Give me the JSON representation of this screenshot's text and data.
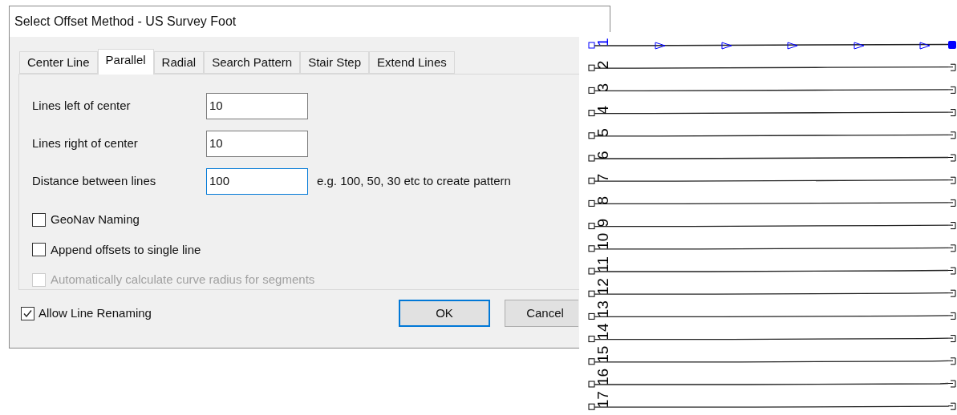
{
  "window": {
    "title": "Select Offset Method - US Survey Foot"
  },
  "tabs": [
    {
      "label": "Center Line",
      "selected": false
    },
    {
      "label": "Parallel",
      "selected": true
    },
    {
      "label": "Radial",
      "selected": false
    },
    {
      "label": "Search Pattern",
      "selected": false
    },
    {
      "label": "Stair Step",
      "selected": false
    },
    {
      "label": "Extend Lines",
      "selected": false
    }
  ],
  "fields": [
    {
      "label": "Lines left of center",
      "value": "10",
      "focused": false
    },
    {
      "label": "Lines right of center",
      "value": "10",
      "focused": false
    },
    {
      "label": "Distance between lines",
      "value": "100",
      "focused": true,
      "hint": "e.g. 100, 50, 30 etc to create pattern"
    }
  ],
  "options": [
    {
      "label": "GeoNav Naming",
      "checked": false,
      "disabled": false
    },
    {
      "label": "Append offsets to single line",
      "checked": false,
      "disabled": false
    },
    {
      "label": "Automatically calculate curve radius for segments",
      "checked": false,
      "disabled": true
    }
  ],
  "allow_renaming": {
    "label": "Allow Line Renaming",
    "checked": true
  },
  "buttons": [
    {
      "label": "OK",
      "default": true
    },
    {
      "label": "Cancel",
      "default": false
    }
  ],
  "canvas": {
    "lines": [
      {
        "label": "1",
        "selected": true
      },
      {
        "label": "2",
        "selected": false
      },
      {
        "label": "3",
        "selected": false
      },
      {
        "label": "4",
        "selected": false
      },
      {
        "label": "5",
        "selected": false
      },
      {
        "label": "6",
        "selected": false
      },
      {
        "label": "7",
        "selected": false
      },
      {
        "label": "8",
        "selected": false
      },
      {
        "label": "9",
        "selected": false
      },
      {
        "label": "10",
        "selected": false
      },
      {
        "label": "11",
        "selected": false
      },
      {
        "label": "12",
        "selected": false
      },
      {
        "label": "13",
        "selected": false
      },
      {
        "label": "14",
        "selected": false
      },
      {
        "label": "15",
        "selected": false
      },
      {
        "label": "16",
        "selected": false
      },
      {
        "label": "17",
        "selected": false
      }
    ]
  }
}
